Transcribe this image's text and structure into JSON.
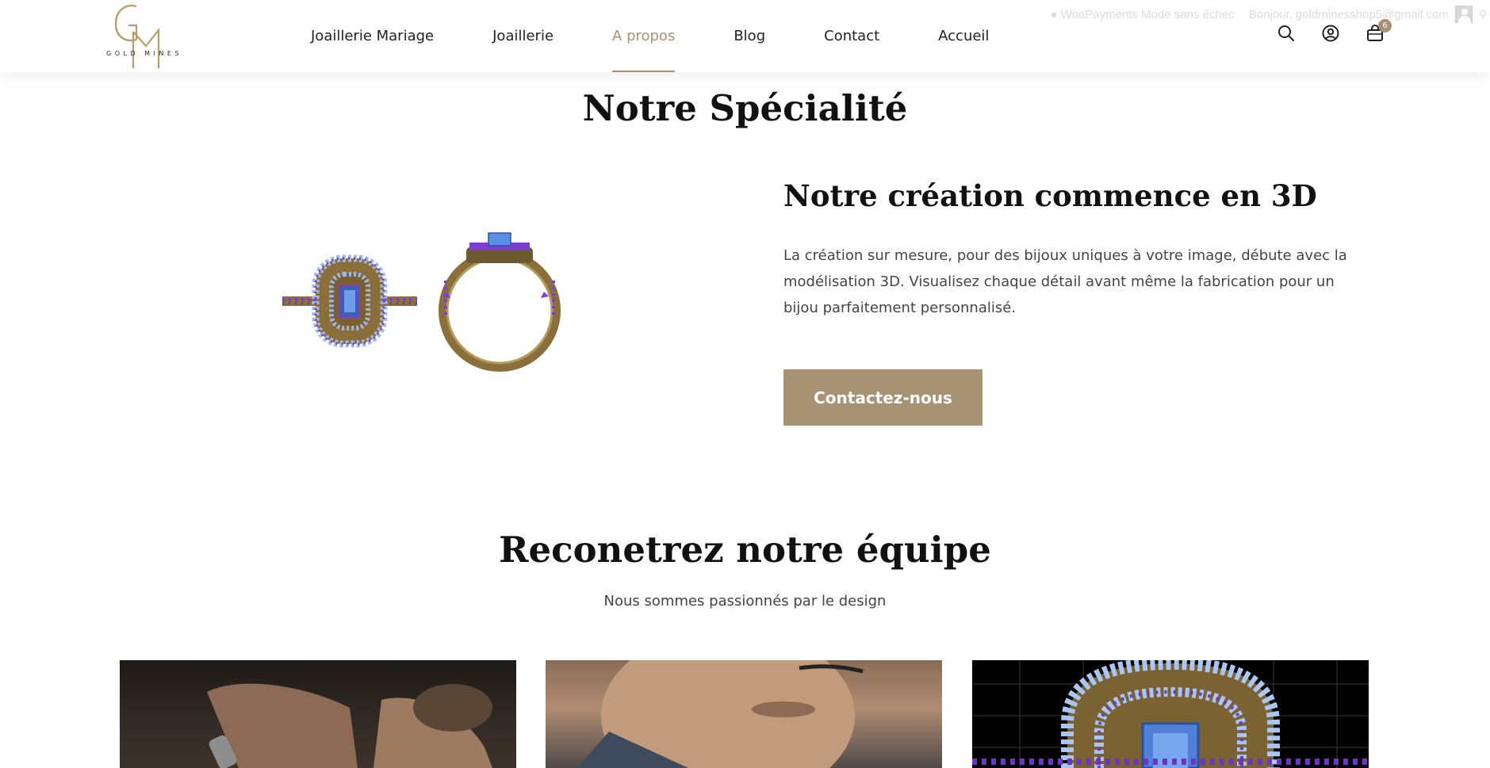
{
  "header": {
    "logo_text": "GOLD MINES",
    "nav": [
      {
        "label": "Joaillerie Mariage",
        "active": false
      },
      {
        "label": "Joaillerie",
        "active": false
      },
      {
        "label": "A propos",
        "active": true
      },
      {
        "label": "Blog",
        "active": false
      },
      {
        "label": "Contact",
        "active": false
      },
      {
        "label": "Accueil",
        "active": false
      }
    ],
    "admin_bar": {
      "payments_notice": "● WooPayments Mode sans échec",
      "greeting": "Bonjour, goldminesshop5@gmail.com"
    },
    "icons": [
      "search-icon",
      "account-icon",
      "cart-icon"
    ],
    "cart_count": "6"
  },
  "specialite": {
    "title": "Notre Spécialité",
    "feature_title": "Notre création commence en 3D",
    "feature_text": "La création sur mesure, pour des bijoux uniques à votre image, débute avec la modélisation 3D. Visualisez chaque détail avant même la fabrication pour un bijou parfaitement personnalisé.",
    "cta_label": "Contactez-nous"
  },
  "team": {
    "title": "Reconetrez notre équipe",
    "subtitle": "Nous sommes passionnés par le design"
  },
  "colors": {
    "accent": "#a89274",
    "heading": "#111111",
    "body_text": "#444444",
    "gold": "#a6893f",
    "gem_blue": "#5b8ee6",
    "amethyst": "#7a3fd0"
  }
}
